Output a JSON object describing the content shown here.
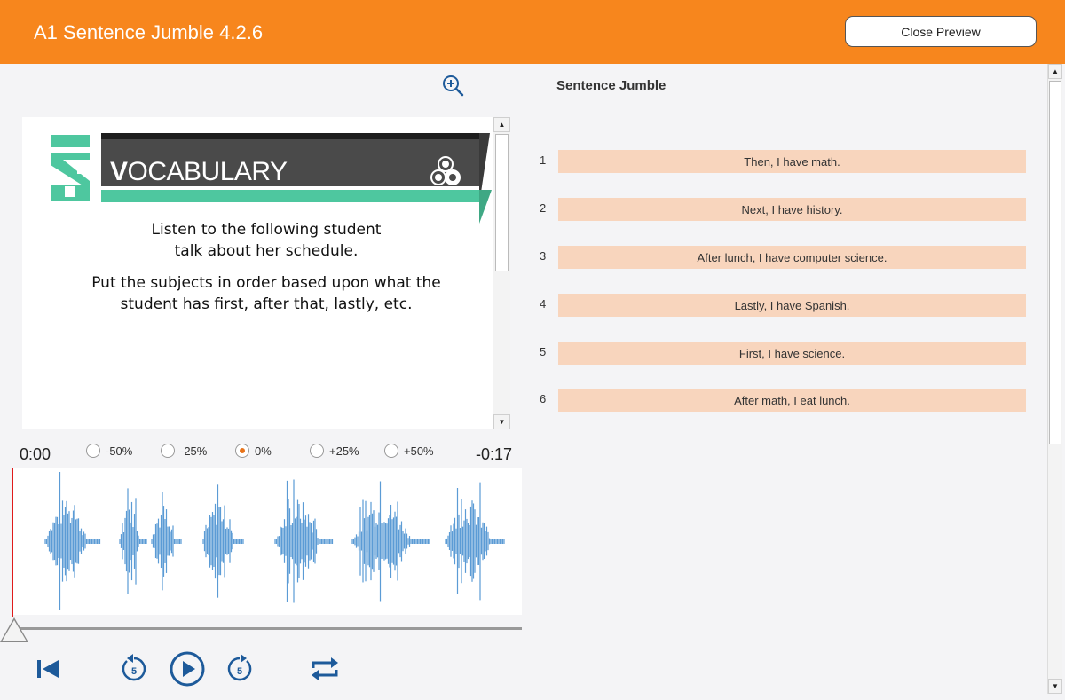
{
  "header": {
    "title": "A1 Sentence Jumble 4.2.6",
    "close_label": "Close Preview"
  },
  "slide": {
    "logo_text": "A1",
    "banner_text_initial": "V",
    "banner_text_rest": "OCABULARY",
    "instruction_1_line_1": "Listen to the following student",
    "instruction_1_line_2": "talk about her schedule.",
    "instruction_2_line_1": "Put the subjects in order based upon what the",
    "instruction_2_line_2": "student has first, after that, lastly, etc."
  },
  "player": {
    "time_elapsed": "0:00",
    "time_remaining": "-0:17",
    "speed_options": [
      "-50%",
      "-25%",
      "0%",
      "+25%",
      "+50%"
    ],
    "selected_speed": "0%",
    "progress": 0,
    "skip_seconds": "5"
  },
  "jumble": {
    "title": "Sentence Jumble",
    "items": [
      {
        "num": "1",
        "text": "Then, I have math."
      },
      {
        "num": "2",
        "text": "Next, I have history."
      },
      {
        "num": "3",
        "text": "After lunch, I have computer science."
      },
      {
        "num": "4",
        "text": "Lastly, I have Spanish."
      },
      {
        "num": "5",
        "text": "First, I have science."
      },
      {
        "num": "6",
        "text": "After math, I eat lunch."
      }
    ]
  },
  "icons": {
    "zoom": "zoom-in-icon",
    "restart": "skip-to-start-icon",
    "rewind": "rewind-5-icon",
    "play": "play-icon",
    "forward": "forward-5-icon",
    "loop": "repeat-icon"
  },
  "colors": {
    "header_bg": "#f7861d",
    "card_bg": "#f8d5bd",
    "accent_green": "#4ec79f",
    "waveform": "#5b9bd5",
    "control_blue": "#1d5a9a",
    "playhead": "#e01b1b"
  }
}
